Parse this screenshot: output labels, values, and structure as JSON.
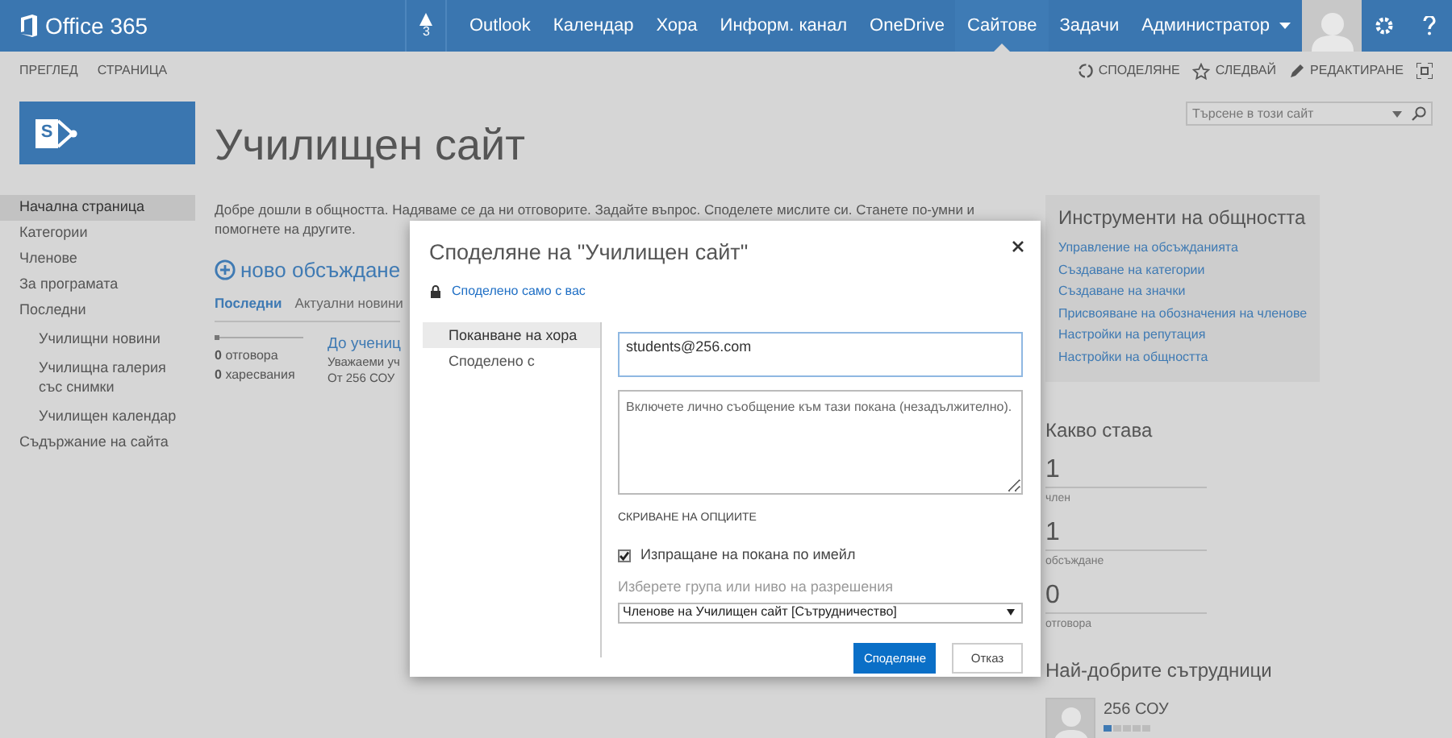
{
  "top_bar": {
    "brand": "Office 365",
    "notifications": {
      "count": "3"
    },
    "nav": [
      {
        "label": "Outlook",
        "selected": false
      },
      {
        "label": "Календар",
        "selected": false
      },
      {
        "label": "Хора",
        "selected": false
      },
      {
        "label": "Информ. канал",
        "selected": false
      },
      {
        "label": "OneDrive",
        "selected": false
      },
      {
        "label": "Сайтове",
        "selected": true
      },
      {
        "label": "Задачи",
        "selected": false
      },
      {
        "label": "Администратор",
        "selected": false
      }
    ]
  },
  "ribbon": {
    "left": [
      "ПРЕГЛЕД",
      "СТРАНИЦА"
    ],
    "right": [
      {
        "kind": "share",
        "label": "СПОДЕЛЯНЕ"
      },
      {
        "kind": "follow",
        "label": "СЛЕДВАЙ"
      },
      {
        "kind": "edit",
        "label": "РЕДАКТИРАНЕ"
      }
    ]
  },
  "site": {
    "logo_letter": "S",
    "title": "Училищен сайт",
    "search": {
      "placeholder": "Търсене в този сайт"
    }
  },
  "sidebar": {
    "items": [
      {
        "label": "Начална страница",
        "selected": true
      },
      {
        "label": "Категории",
        "selected": false
      },
      {
        "label": "Членове",
        "selected": false
      },
      {
        "label": "За програмата",
        "selected": false
      },
      {
        "label": "Последни",
        "selected": false,
        "children": [
          {
            "label": "Училищни новини",
            "selected": false
          },
          {
            "label": "Училищна галерия със снимки",
            "selected": false
          },
          {
            "label": "Училищен календар",
            "selected": false
          }
        ]
      },
      {
        "label": "Съдържание на сайта",
        "selected": false
      }
    ]
  },
  "main": {
    "welcome": "Добре дошли в общността. Надяваме се да ни отговорите. Задайте въпрос. Споделете мислите си. Станете по-умни и помогнете на другите.",
    "new_discussion": "ново обсъждане",
    "tabs": [
      {
        "label": "Последни",
        "selected": true
      },
      {
        "label": "Актуални новини",
        "selected": false
      }
    ],
    "post": {
      "replies": {
        "count": "0",
        "label": "отговора"
      },
      "likes": {
        "count": "0",
        "label": "харесвания"
      },
      "title": "До учениц",
      "excerpt": "Уважаеми уч",
      "author": "От 256 СОУ"
    }
  },
  "community_tools": {
    "title": "Инструменти на общността",
    "links": [
      "Управление на обсъжданията",
      "Създаване на категории",
      "Създаване на значки",
      "Присвояване на обозначения на членове",
      "Настройки на репутация",
      "Настройки на общността"
    ]
  },
  "whats_happening": {
    "title": "Какво става",
    "stats": [
      {
        "value": "1",
        "label": "член"
      },
      {
        "value": "1",
        "label": "обсъждане"
      },
      {
        "value": "0",
        "label": "отговора"
      }
    ]
  },
  "top_contributors": {
    "title": "Най-добрите сътрудници",
    "people": [
      {
        "name": "256 СОУ",
        "stars": 1
      }
    ]
  },
  "dialog": {
    "title": "Споделяне на \"Училищен сайт\"",
    "shared_note": "Споделено само с вас",
    "tabs": [
      {
        "label": "Поканване на хора",
        "selected": true
      },
      {
        "label": "Споделено с",
        "selected": false
      }
    ],
    "invite_field": {
      "value": "students@256.com"
    },
    "message_field": {
      "placeholder": "Включете лично съобщение към тази покана (незадължително)."
    },
    "options_toggle": "СКРИВАНЕ НА ОПЦИИТЕ",
    "send_email": {
      "label": "Изпращане на покана по имейл",
      "checked": true
    },
    "permission": {
      "label": "Изберете група или ниво на разрешения",
      "value": "Членове на Училищен сайт [Сътрудничество]"
    },
    "buttons": [
      {
        "label": "Споделяне",
        "kind": "primary"
      },
      {
        "label": "Отказ",
        "kind": "secondary"
      }
    ]
  }
}
